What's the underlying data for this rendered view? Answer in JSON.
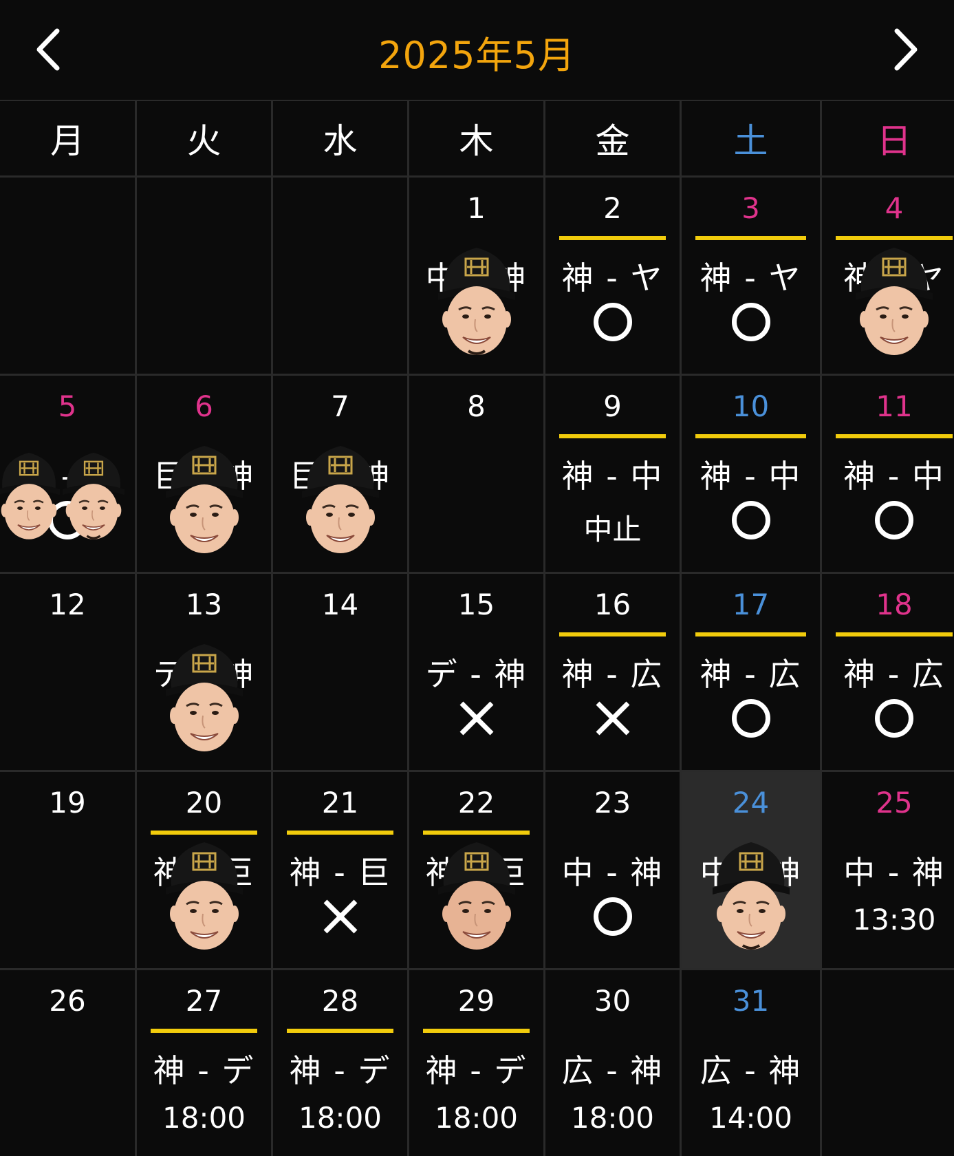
{
  "header": {
    "title": "2025年5月",
    "prev_icon": "chevron-left-icon",
    "next_icon": "chevron-right-icon"
  },
  "colors": {
    "accent": "#f3a50d",
    "home_bar": "#f2cc0c",
    "saturday": "#4a90d9",
    "sunday": "#e0338c",
    "today_bg": "#2b2b2b"
  },
  "weekdays": [
    {
      "label": "月",
      "type": "weekday"
    },
    {
      "label": "火",
      "type": "weekday"
    },
    {
      "label": "水",
      "type": "weekday"
    },
    {
      "label": "木",
      "type": "weekday"
    },
    {
      "label": "金",
      "type": "weekday"
    },
    {
      "label": "土",
      "type": "sat"
    },
    {
      "label": "日",
      "type": "sun"
    }
  ],
  "days": [
    null,
    null,
    null,
    {
      "day": "1",
      "color": "weekday",
      "matchup": "中 - 神",
      "avatar": "player-a"
    },
    {
      "day": "2",
      "color": "weekday",
      "home": true,
      "matchup": "神 - ヤ",
      "mark": "circle"
    },
    {
      "day": "3",
      "color": "sun",
      "home": true,
      "matchup": "神 - ヤ",
      "mark": "circle"
    },
    {
      "day": "4",
      "color": "sun",
      "home": true,
      "matchup": "神 - ヤ",
      "avatar": "player-b"
    },
    {
      "day": "5",
      "color": "sun",
      "matchup": "巨 - 神",
      "mark": "circle",
      "avatar": "pair"
    },
    {
      "day": "6",
      "color": "sun",
      "matchup": "巨 - 神",
      "avatar": "player-b"
    },
    {
      "day": "7",
      "color": "weekday",
      "matchup": "巨 - 神",
      "avatar": "player-b"
    },
    {
      "day": "8",
      "color": "weekday"
    },
    {
      "day": "9",
      "color": "weekday",
      "home": true,
      "matchup": "神 - 中",
      "text": "中止"
    },
    {
      "day": "10",
      "color": "sat",
      "home": true,
      "matchup": "神 - 中",
      "mark": "circle"
    },
    {
      "day": "11",
      "color": "sun",
      "home": true,
      "matchup": "神 - 中",
      "mark": "circle"
    },
    {
      "day": "12",
      "color": "weekday"
    },
    {
      "day": "13",
      "color": "weekday",
      "matchup": "テ - 神",
      "avatar": "player-c"
    },
    {
      "day": "14",
      "color": "weekday"
    },
    {
      "day": "15",
      "color": "weekday",
      "matchup": "デ - 神",
      "mark": "x"
    },
    {
      "day": "16",
      "color": "weekday",
      "home": true,
      "matchup": "神 - 広",
      "mark": "x"
    },
    {
      "day": "17",
      "color": "sat",
      "home": true,
      "matchup": "神 - 広",
      "mark": "circle"
    },
    {
      "day": "18",
      "color": "sun",
      "home": true,
      "matchup": "神 - 広",
      "mark": "circle"
    },
    {
      "day": "19",
      "color": "weekday"
    },
    {
      "day": "20",
      "color": "weekday",
      "home": true,
      "matchup": "神 - 巨",
      "avatar": "player-b"
    },
    {
      "day": "21",
      "color": "weekday",
      "home": true,
      "matchup": "神 - 巨",
      "mark": "x"
    },
    {
      "day": "22",
      "color": "weekday",
      "home": true,
      "matchup": "神 - 巨",
      "avatar": "player-d"
    },
    {
      "day": "23",
      "color": "weekday",
      "matchup": "中 - 神",
      "mark": "circle"
    },
    {
      "day": "24",
      "color": "sat",
      "today": true,
      "matchup": "中 - 神",
      "avatar": "player-a"
    },
    {
      "day": "25",
      "color": "sun",
      "matchup": "中 - 神",
      "text": "13:30"
    },
    {
      "day": "26",
      "color": "weekday"
    },
    {
      "day": "27",
      "color": "weekday",
      "home": true,
      "matchup": "神 - デ",
      "text": "18:00"
    },
    {
      "day": "28",
      "color": "weekday",
      "home": true,
      "matchup": "神 - デ",
      "text": "18:00"
    },
    {
      "day": "29",
      "color": "weekday",
      "home": true,
      "matchup": "神 - デ",
      "text": "18:00"
    },
    {
      "day": "30",
      "color": "weekday",
      "matchup": "広 - 神",
      "text": "18:00"
    },
    {
      "day": "31",
      "color": "sat",
      "matchup": "広 - 神",
      "text": "14:00"
    },
    null
  ]
}
